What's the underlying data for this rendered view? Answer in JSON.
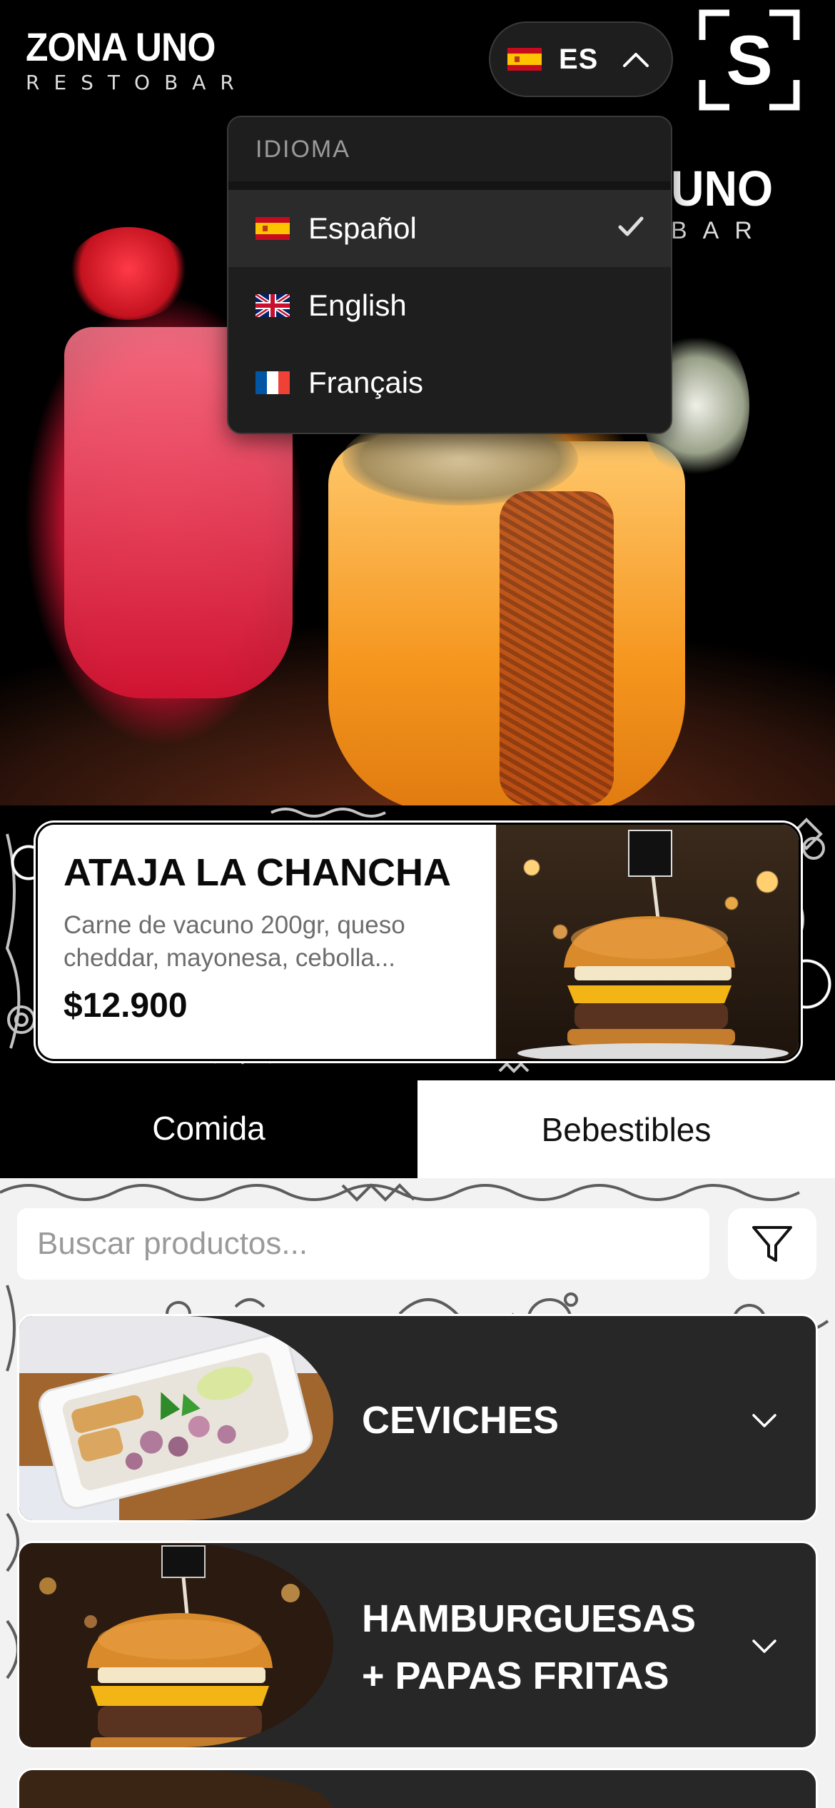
{
  "header": {
    "logo_main": "ZONA UNO",
    "logo_sub": "RESTOBAR",
    "language_code": "ES",
    "brand_icon_letter": "S"
  },
  "hero": {
    "sign_main": "UNO",
    "sign_sub": "BAR"
  },
  "language_dropdown": {
    "heading": "IDIOMA",
    "options": [
      {
        "label": "Español",
        "flag": "spain-flag-icon",
        "selected": true
      },
      {
        "label": "English",
        "flag": "uk-flag-icon",
        "selected": false
      },
      {
        "label": "Français",
        "flag": "france-flag-icon",
        "selected": false
      }
    ]
  },
  "promo": {
    "title": "ATAJA LA CHANCHA",
    "description": "Carne de vacuno 200gr, queso cheddar, mayonesa, cebolla...",
    "price": "$12.900"
  },
  "tabs": [
    {
      "label": "Comida",
      "active": true
    },
    {
      "label": "Bebestibles",
      "active": false
    }
  ],
  "search": {
    "placeholder": "Buscar productos..."
  },
  "categories": [
    {
      "line1": "CEVICHES",
      "line2": ""
    },
    {
      "line1": "HAMBURGUESAS",
      "line2": "+ PAPAS FRITAS"
    }
  ],
  "colors": {
    "header_bg": "#000000",
    "dropdown_bg": "#1f1e1e",
    "category_card_bg": "#272727"
  }
}
